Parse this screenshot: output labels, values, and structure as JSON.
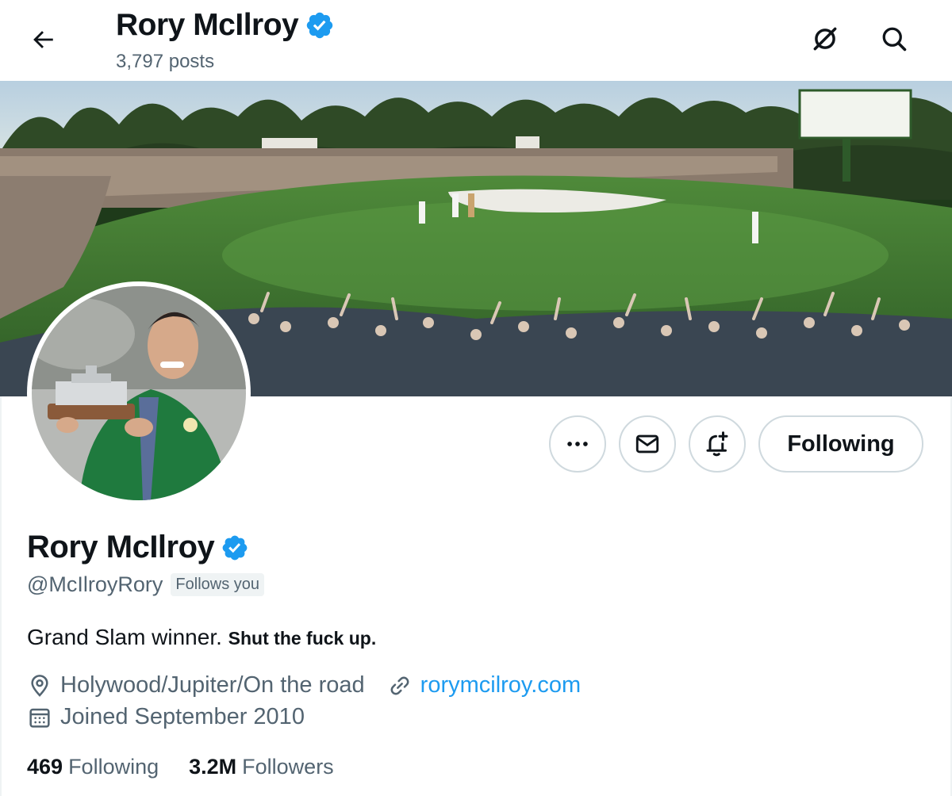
{
  "header": {
    "title": "Rory McIlroy",
    "posts_count": "3,797 posts",
    "icons": [
      "back-arrow-icon",
      "verified-badge-icon",
      "grok-icon",
      "search-icon"
    ]
  },
  "profile": {
    "display_name": "Rory McIlroy",
    "handle": "@McIlroyRory",
    "follows_you": "Follows you",
    "bio_plain": "Grand Slam winner.",
    "bio_bold": "Shut the fuck up.",
    "location": "Holywood/Jupiter/On the road",
    "website": "rorymcilroy.com",
    "joined": "Joined September 2010",
    "following_count": "469",
    "following_label": "Following",
    "followers_count": "3.2M",
    "followers_label": "Followers"
  },
  "actions": {
    "more_icon": "more-dots-icon",
    "message_icon": "envelope-icon",
    "notify_icon": "bell-plus-icon",
    "follow_label": "Following"
  },
  "colors": {
    "accent": "#1d9bf0",
    "verified": "#1d9bf0",
    "text_primary": "#0f1419",
    "text_secondary": "#536471"
  }
}
